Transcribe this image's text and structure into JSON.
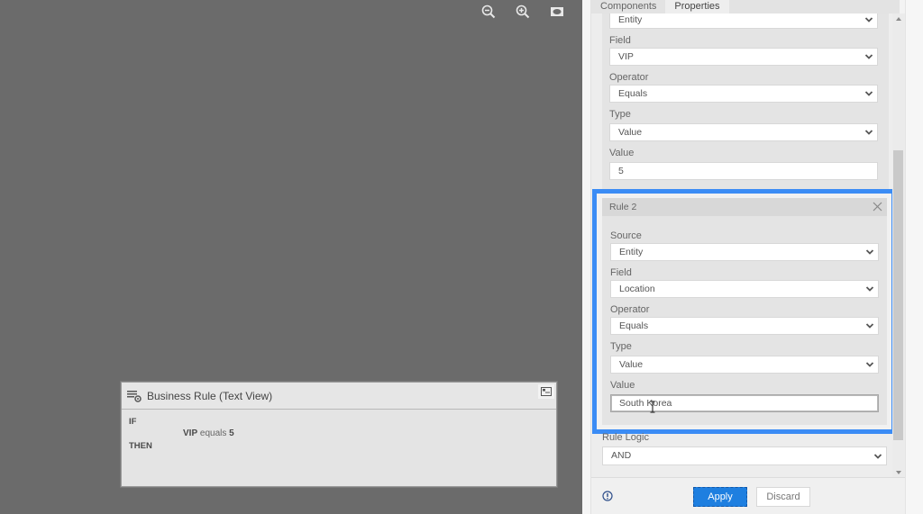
{
  "canvas": {
    "toolbar": [
      {
        "name": "zoom-out-icon",
        "label": "Zoom out"
      },
      {
        "name": "zoom-in-icon",
        "label": "Zoom in"
      },
      {
        "name": "fit-to-screen-icon",
        "label": "Fit to screen"
      }
    ],
    "business_rule": {
      "title": "Business Rule (Text View)",
      "if_label": "IF",
      "condition_field": "VIP",
      "condition_operator": "equals",
      "condition_value": "5",
      "then_label": "THEN"
    }
  },
  "side_panel": {
    "tabs": [
      {
        "label": "Components",
        "active": false
      },
      {
        "label": "Properties",
        "active": true
      }
    ],
    "rule1": {
      "source_value": "Entity",
      "field_label": "Field",
      "field_value": "VIP",
      "operator_label": "Operator",
      "operator_value": "Equals",
      "type_label": "Type",
      "type_value": "Value",
      "value_label": "Value",
      "value_value": "5"
    },
    "rule2": {
      "title": "Rule 2",
      "source_label": "Source",
      "source_value": "Entity",
      "field_label": "Field",
      "field_value": "Location",
      "operator_label": "Operator",
      "operator_value": "Equals",
      "type_label": "Type",
      "type_value": "Value",
      "value_label": "Value",
      "value_value": "South Korea"
    },
    "rule_logic": {
      "label": "Rule Logic",
      "value": "AND"
    },
    "footer": {
      "apply_label": "Apply",
      "discard_label": "Discard"
    }
  },
  "colors": {
    "highlight": "#3b8cf5",
    "apply_button": "#1e7fe0",
    "canvas_bg": "#6b6b6b"
  }
}
